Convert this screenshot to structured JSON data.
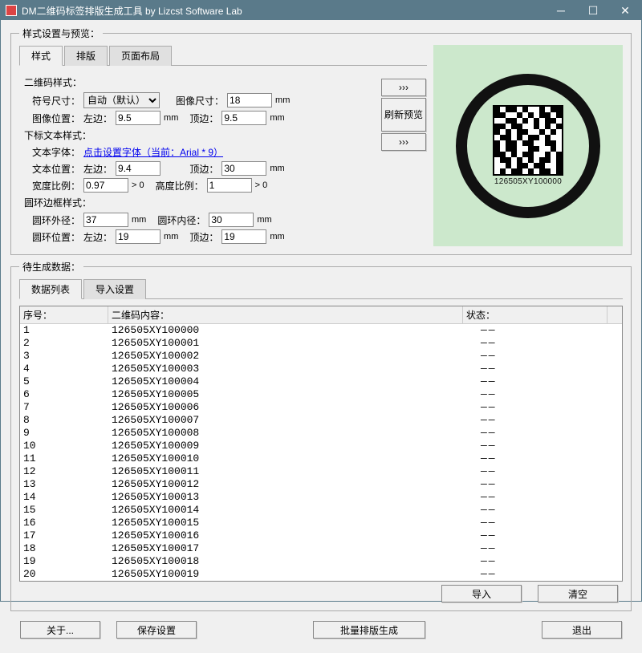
{
  "window": {
    "title": "DM二维码标签排版生成工具   by Lizcst Software Lab"
  },
  "groupbox": {
    "style_preview": "样式设置与预览：",
    "data_gen": "待生成数据："
  },
  "tabs": {
    "style": "样式",
    "layout": "排版",
    "page": "页面布局"
  },
  "style": {
    "qr_section": "二维码样式：",
    "symbol_size_label": "符号尺寸：",
    "symbol_size_value": "自动（默认）",
    "image_size_label": "图像尺寸：",
    "image_size_value": "18",
    "image_pos_label": "图像位置：",
    "left_label": "左边：",
    "top_label": "顶边：",
    "image_left": "9.5",
    "image_top": "9.5",
    "mm": "mm",
    "subscript_section": "下标文本样式：",
    "font_label": "文本字体：",
    "font_link": "点击设置字体（当前：Arial * 9）",
    "text_pos_label": "文本位置：",
    "text_left": "9.4",
    "text_top": "30",
    "width_ratio_label": "宽度比例：",
    "width_ratio": "0.97",
    "gt0": "> 0",
    "height_ratio_label": "高度比例：",
    "height_ratio": "1",
    "ring_section": "圆环边框样式：",
    "ring_outer_label": "圆环外径：",
    "ring_outer": "37",
    "ring_inner_label": "圆环内径：",
    "ring_inner": "30",
    "ring_pos_label": "圆环位置：",
    "ring_left": "19",
    "ring_top": "19"
  },
  "refresh": {
    "arrows": "›››",
    "label": "刷新预览"
  },
  "preview": {
    "caption": "126505XY100000"
  },
  "data_tabs": {
    "list": "数据列表",
    "import": "导入设置"
  },
  "table": {
    "headers": {
      "seq": "序号：",
      "content": "二维码内容：",
      "status": "状态："
    },
    "rows": [
      {
        "seq": "1",
        "content": "126505XY100000",
        "status": "——"
      },
      {
        "seq": "2",
        "content": "126505XY100001",
        "status": "——"
      },
      {
        "seq": "3",
        "content": "126505XY100002",
        "status": "——"
      },
      {
        "seq": "4",
        "content": "126505XY100003",
        "status": "——"
      },
      {
        "seq": "5",
        "content": "126505XY100004",
        "status": "——"
      },
      {
        "seq": "6",
        "content": "126505XY100005",
        "status": "——"
      },
      {
        "seq": "7",
        "content": "126505XY100006",
        "status": "——"
      },
      {
        "seq": "8",
        "content": "126505XY100007",
        "status": "——"
      },
      {
        "seq": "9",
        "content": "126505XY100008",
        "status": "——"
      },
      {
        "seq": "10",
        "content": "126505XY100009",
        "status": "——"
      },
      {
        "seq": "11",
        "content": "126505XY100010",
        "status": "——"
      },
      {
        "seq": "12",
        "content": "126505XY100011",
        "status": "——"
      },
      {
        "seq": "13",
        "content": "126505XY100012",
        "status": "——"
      },
      {
        "seq": "14",
        "content": "126505XY100013",
        "status": "——"
      },
      {
        "seq": "15",
        "content": "126505XY100014",
        "status": "——"
      },
      {
        "seq": "16",
        "content": "126505XY100015",
        "status": "——"
      },
      {
        "seq": "17",
        "content": "126505XY100016",
        "status": "——"
      },
      {
        "seq": "18",
        "content": "126505XY100017",
        "status": "——"
      },
      {
        "seq": "19",
        "content": "126505XY100018",
        "status": "——"
      },
      {
        "seq": "20",
        "content": "126505XY100019",
        "status": "——"
      }
    ]
  },
  "buttons": {
    "import": "导入",
    "clear": "清空",
    "about": "关于...",
    "save": "保存设置",
    "batch": "批量排版生成",
    "exit": "退出"
  }
}
